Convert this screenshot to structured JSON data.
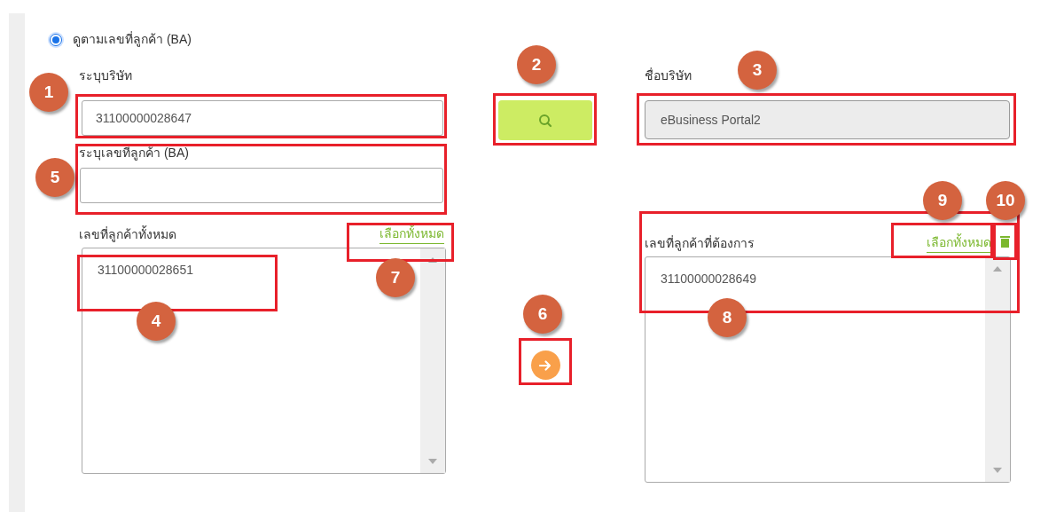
{
  "radio": {
    "label": "ดูตามเลขที่ลูกค้า (BA)",
    "selected": true
  },
  "company_id": {
    "label": "ระบุบริษัท",
    "value": "31100000028647"
  },
  "company_name": {
    "label": "ชื่อบริษัท",
    "value": "eBusiness Portal2"
  },
  "ba_field": {
    "label": "ระบุเลขที่ลูกค้า (BA)"
  },
  "all_customers": {
    "label": "เลขที่ลูกค้าทั้งหมด",
    "select_all": "เลือกทั้งหมด",
    "items": [
      "31100000028651"
    ]
  },
  "wanted_customers": {
    "label": "เลขที่ลูกค้าที่ต้องการ",
    "select_all": "เลือกทั้งหมด",
    "items": [
      "31100000028649"
    ]
  },
  "annotations": [
    {
      "number": "1"
    },
    {
      "number": "2"
    },
    {
      "number": "3"
    },
    {
      "number": "4"
    },
    {
      "number": "5"
    },
    {
      "number": "6"
    },
    {
      "number": "7"
    },
    {
      "number": "8"
    },
    {
      "number": "9"
    },
    {
      "number": "10"
    }
  ]
}
